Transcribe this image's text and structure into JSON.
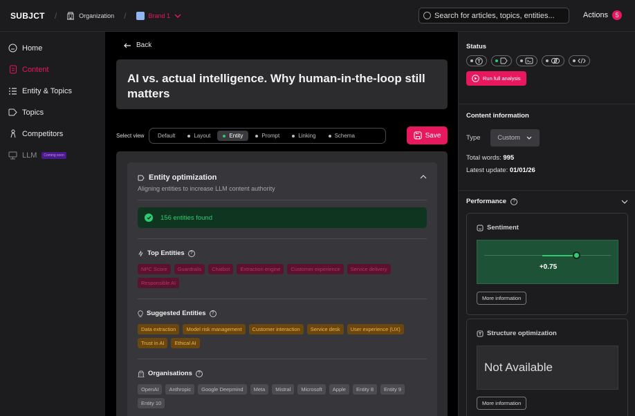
{
  "topbar": {
    "logo": "SUBJCT",
    "organization": "Organization",
    "brand": "Brand 1",
    "search_placeholder": "Search for articles, topics, entities...",
    "actions_label": "Actions",
    "actions_count": "5",
    "colors": {
      "accent": "#e8185f"
    }
  },
  "sidebar": {
    "items": [
      {
        "label": "Home",
        "icon": "home-icon"
      },
      {
        "label": "Content",
        "icon": "document-icon",
        "active": true
      },
      {
        "label": "Entity & Topics",
        "icon": "list-icon"
      },
      {
        "label": "Topics",
        "icon": "tag-icon"
      },
      {
        "label": "Competitors",
        "icon": "person-icon"
      },
      {
        "label": "LLM",
        "icon": "llm-icon",
        "badge": "Coming soon"
      }
    ]
  },
  "main": {
    "back_label": "Back",
    "title": "AI vs. actual intelligence. Why human-in-the-loop still matters",
    "select_view_label": "Select view",
    "views": [
      "Default",
      "Layout",
      "Entity",
      "Prompt",
      "Linking",
      "Schema"
    ],
    "active_view": "Entity",
    "save_label": "Save",
    "entity_panel": {
      "title": "Entity optimization",
      "subtitle": "Aligning entities to increase LLM content authority",
      "found_text": "156 entities found",
      "top_entities": {
        "title": "Top Entities",
        "tags": [
          "NPC Score",
          "Guardrails",
          "Chatbot",
          "Extraction engine",
          "Customer experience",
          "Service delivery",
          "Responsible AI"
        ]
      },
      "suggested_entities": {
        "title": "Suggested Entities",
        "tags": [
          "Data extraction",
          "Model risk management",
          "Customer interaction",
          "Service desk",
          "User experience (UX)",
          "Trust in AI",
          "Ethical AI"
        ]
      },
      "organisations": {
        "title": "Organisations",
        "tags": [
          "OpenAI",
          "Anthropic",
          "Google Deepmind",
          "Meta",
          "Mistral",
          "Microsoft",
          "Apple",
          "Entity 8",
          "Entity 9",
          "Entity 10"
        ]
      }
    }
  },
  "right": {
    "status_title": "Status",
    "run_label": "Run full analysis",
    "content_info_title": "Content information",
    "type_label": "Type",
    "type_value": "Custom",
    "total_words_label": "Total words:",
    "total_words": "995",
    "latest_update_label": "Latest update:",
    "latest_update": "01/01/26",
    "performance_title": "Performance",
    "sentiment": {
      "title": "Sentiment",
      "value": "+0.75",
      "level": 0.75,
      "more_label": "More information"
    },
    "structure": {
      "title": "Structure optimization",
      "value": "Not Available",
      "more_label": "More information"
    }
  }
}
